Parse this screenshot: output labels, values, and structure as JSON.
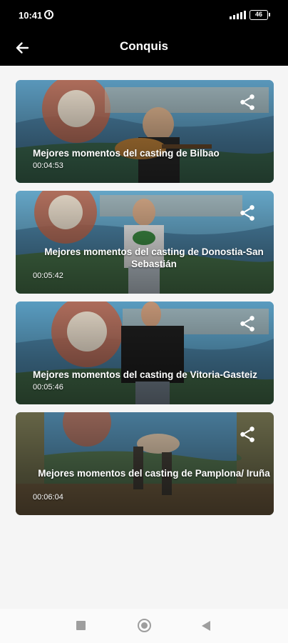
{
  "status_bar": {
    "time": "10:41",
    "battery": "46"
  },
  "app_bar": {
    "title": "Conquis"
  },
  "videos": [
    {
      "title": "Mejores momentos del casting de Bilbao",
      "duration": "00:04:53"
    },
    {
      "title": "Mejores momentos del casting de Donostia-San Sebastián",
      "duration": "00:05:42"
    },
    {
      "title": "Mejores momentos del casting de Vitoria-Gasteiz",
      "duration": "00:05:46"
    },
    {
      "title": "Mejores momentos del casting de Pamplona/ Iruña",
      "duration": "00:06:04"
    }
  ],
  "icons": {
    "back": "arrow-left-icon",
    "share": "share-icon",
    "alarm": "alarm-icon",
    "signal": "signal-icon",
    "battery": "battery-icon",
    "nav_recents": "square-icon",
    "nav_home": "circle-icon",
    "nav_back": "triangle-icon"
  },
  "colors": {
    "app_bar": "#000000",
    "background": "#f5f5f5",
    "card_text": "#ffffff",
    "nav_icons": "#9e9e9e"
  }
}
